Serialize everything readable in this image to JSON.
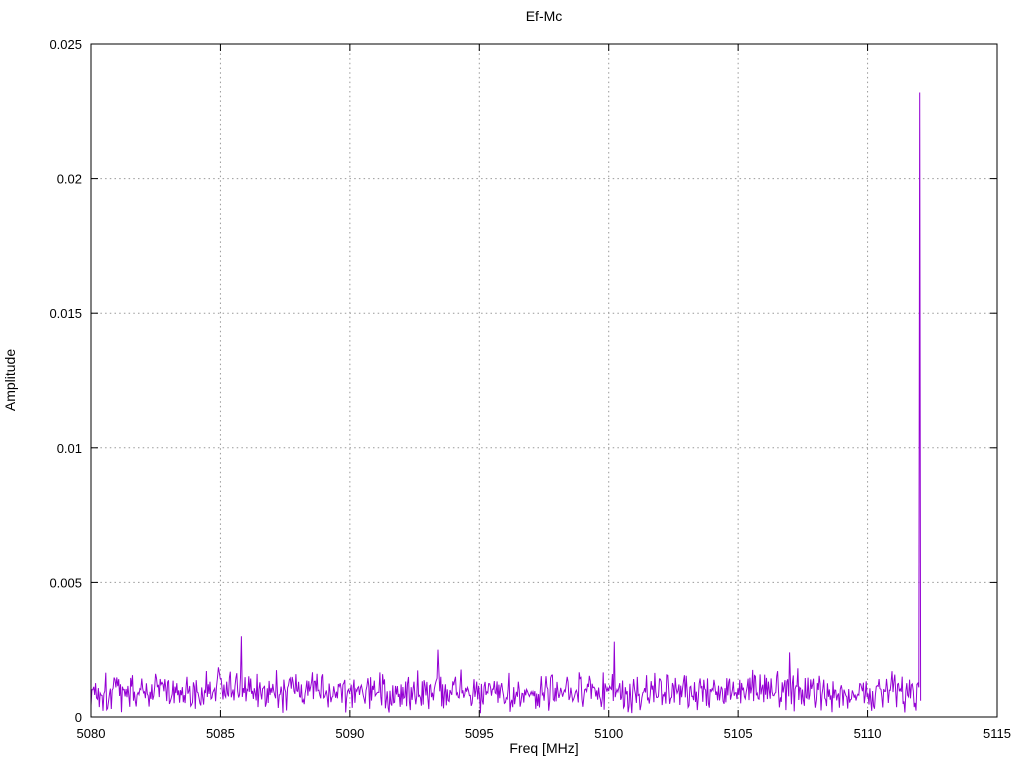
{
  "chart_data": {
    "type": "line",
    "title": "Ef-Mc",
    "xlabel": "Freq [MHz]",
    "ylabel": "Amplitude",
    "xlim": [
      5080,
      5115
    ],
    "ylim": [
      0,
      0.025
    ],
    "x_ticks": [
      5080,
      5085,
      5090,
      5095,
      5100,
      5105,
      5110,
      5115
    ],
    "x_tick_labels": [
      "5080",
      "5085",
      "5090",
      "5095",
      "5100",
      "5105",
      "5110",
      "5115"
    ],
    "y_ticks": [
      0,
      0.005,
      0.01,
      0.015,
      0.02,
      0.025
    ],
    "y_tick_labels": [
      "0",
      "0.005",
      "0.01",
      "0.015",
      "0.02",
      "0.025"
    ],
    "legend_position": "none",
    "grid": {
      "visible": true,
      "style": "dotted",
      "color": "#999999"
    },
    "colors": {
      "line": "#9400d3",
      "border": "#000000",
      "background": "#ffffff",
      "text": "#000000"
    },
    "series": [
      {
        "name": "Ef-Mc spectrum",
        "x_start": 5080.0,
        "x_end": 5112.05,
        "n_points": 900,
        "noise_floor": {
          "min": 0.0001,
          "typical_max": 0.0018,
          "mean": 0.0009,
          "burst_chance": 0.03,
          "burst_extra_max": 0.0009,
          "seed": 1337
        },
        "peaks": [
          {
            "x": 5085.8,
            "y": 0.003
          },
          {
            "x": 5093.4,
            "y": 0.0025
          },
          {
            "x": 5100.2,
            "y": 0.0028
          },
          {
            "x": 5107.0,
            "y": 0.0024
          },
          {
            "x": 5112.0,
            "y": 0.0232
          }
        ],
        "end_value": 0.0006
      }
    ]
  }
}
